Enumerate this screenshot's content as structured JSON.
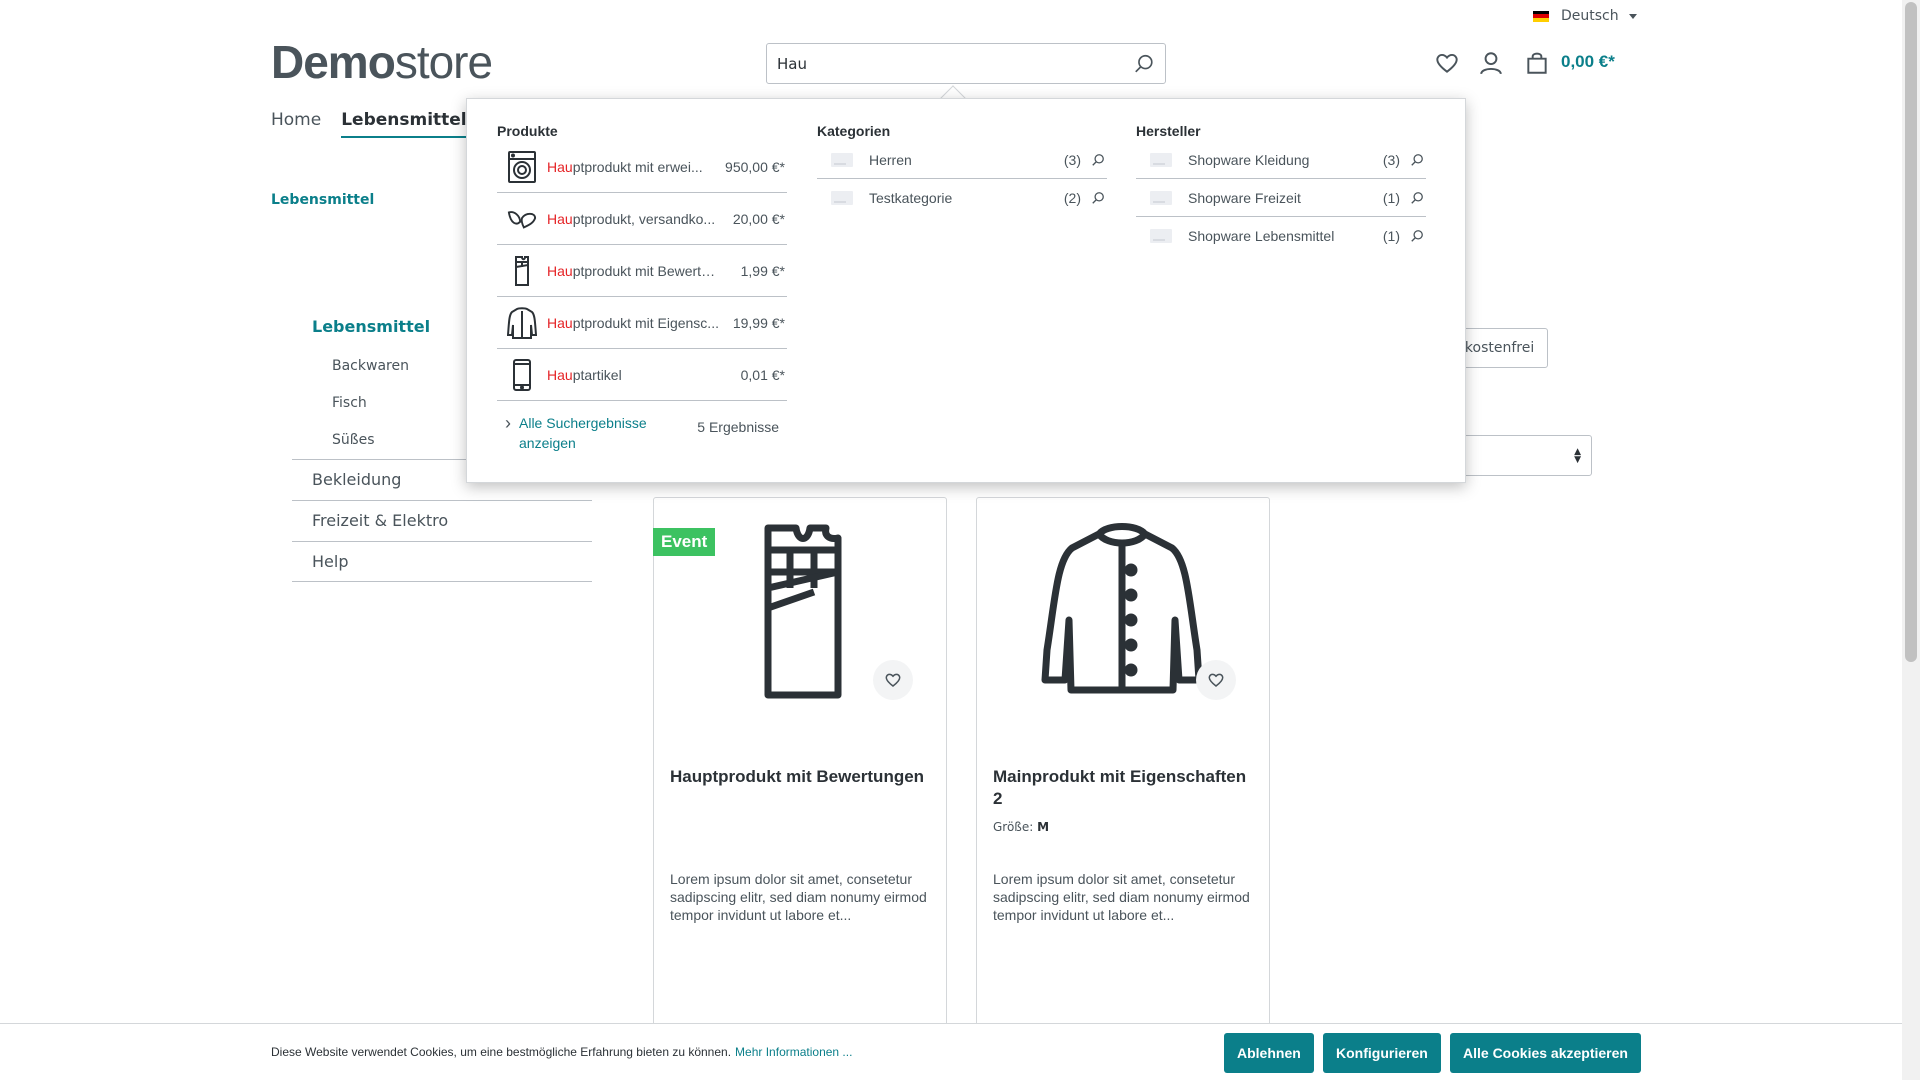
{
  "header": {
    "language": "Deutsch",
    "logo_bold": "Demo",
    "logo_light": "store",
    "search_value": "Hau",
    "cart_total": "0,00 €*"
  },
  "nav": {
    "home": "Home",
    "active": "Lebensmittel"
  },
  "breadcrumb": "Lebensmittel",
  "sidebar": {
    "active": "Lebensmittel",
    "subs": [
      "Backwaren",
      "Fisch",
      "Süßes"
    ],
    "cats": [
      "Bekleidung",
      "Freizeit & Elektro",
      "Help"
    ]
  },
  "filters": {
    "shipping_free_partial": "lkostenfrei"
  },
  "suggest": {
    "products_heading": "Produkte",
    "categories_heading": "Kategorien",
    "manufacturers_heading": "Hersteller",
    "products": [
      {
        "match": "Hau",
        "rest": "ptprodukt mit erwei...",
        "price": "950,00 €*",
        "icon": "washing-machine-icon"
      },
      {
        "match": "Hau",
        "rest": "ptprodukt, versandko...",
        "price": "20,00 €*",
        "icon": "candy-icon"
      },
      {
        "match": "Hau",
        "rest": "ptprodukt mit Bewertu...",
        "price": "1,99 €*",
        "icon": "chocolate-icon"
      },
      {
        "match": "Hau",
        "rest": "ptprodukt mit Eigensc...",
        "price": "19,99 €*",
        "icon": "jacket-icon"
      },
      {
        "match": "Hau",
        "rest": "ptartikel",
        "price": "0,01 €*",
        "icon": "smartphone-icon"
      }
    ],
    "all_results": "Alle Suchergebnisse anzeigen",
    "result_count": "5 Ergebnisse",
    "categories": [
      {
        "name": "Herren",
        "count": "(3)"
      },
      {
        "name": "Testkategorie",
        "count": "(2)"
      }
    ],
    "manufacturers": [
      {
        "name": "Shopware Kleidung",
        "count": "(3)"
      },
      {
        "name": "Shopware Freizeit",
        "count": "(1)"
      },
      {
        "name": "Shopware Lebensmittel",
        "count": "(1)"
      }
    ]
  },
  "products": [
    {
      "badge": "Event",
      "title": "Hauptprodukt mit Bewertungen",
      "variant_label": "",
      "variant_value": "",
      "description": "Lorem ipsum dolor sit amet, consetetur sadipscing elitr, sed diam nonumy eirmod tempor invidunt ut labore et..."
    },
    {
      "badge": "",
      "title": "Mainprodukt mit Eigenschaften 2",
      "variant_label": "Größe:",
      "variant_value": "M",
      "description": "Lorem ipsum dolor sit amet, consetetur sadipscing elitr, sed diam nonumy eirmod tempor invidunt ut labore et..."
    }
  ],
  "cookie": {
    "text": "Diese Website verwendet Cookies, um eine bestmögliche Erfahrung bieten zu können.",
    "link": "Mehr Informationen ...",
    "decline": "Ablehnen",
    "configure": "Konfigurieren",
    "accept_all": "Alle Cookies akzeptieren"
  },
  "colors": {
    "primary": "#0b7f8a",
    "highlight": "#e52427",
    "badge": "#3cc261",
    "text": "#4a545b"
  }
}
